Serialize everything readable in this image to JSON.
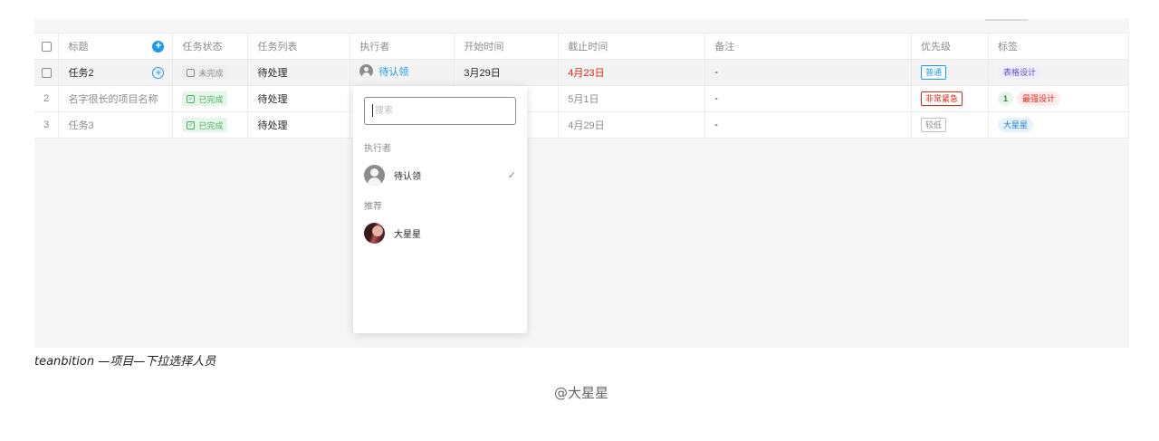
{
  "table": {
    "headers": {
      "title": "标题",
      "status": "任务状态",
      "list": "任务列表",
      "assignee": "执行者",
      "start": "开始时间",
      "due": "截止时间",
      "note": "备注",
      "priority": "优先级",
      "tags": "标签"
    },
    "rows": [
      {
        "index": "",
        "title": "任务2",
        "status": "未完成",
        "list": "待处理",
        "assignee": "待认领",
        "start": "3月29日",
        "due": "4月23日",
        "note": "-",
        "priority": "普通",
        "tags": [
          "表格设计"
        ]
      },
      {
        "index": "2",
        "title": "名字很长的项目名称",
        "status": "已完成",
        "list": "待处理",
        "assignee": "",
        "start": "",
        "due": "5月1日",
        "note": "-",
        "priority": "非常紧急",
        "tags": [
          "1",
          "最强设计"
        ]
      },
      {
        "index": "3",
        "title": "任务3",
        "status": "已完成",
        "list": "待处理",
        "assignee": "",
        "start": "",
        "due": "4月29日",
        "note": "-",
        "priority": "较低",
        "tags": [
          "大星星"
        ]
      }
    ]
  },
  "popover": {
    "search_placeholder": "搜索",
    "section_assignee": "执行者",
    "current_assignee": "待认领",
    "section_recommend": "推荐",
    "recommended_user": "大星星"
  },
  "caption": "teanbition —项目—下拉选择人员",
  "watermark": "@大星星",
  "colors": {
    "accent": "#1b9aee",
    "danger": "#e62412",
    "success": "#45b35c"
  },
  "icons": [
    "checkbox-icon",
    "add-circle-icon",
    "avatar-placeholder-icon",
    "check-icon"
  ]
}
